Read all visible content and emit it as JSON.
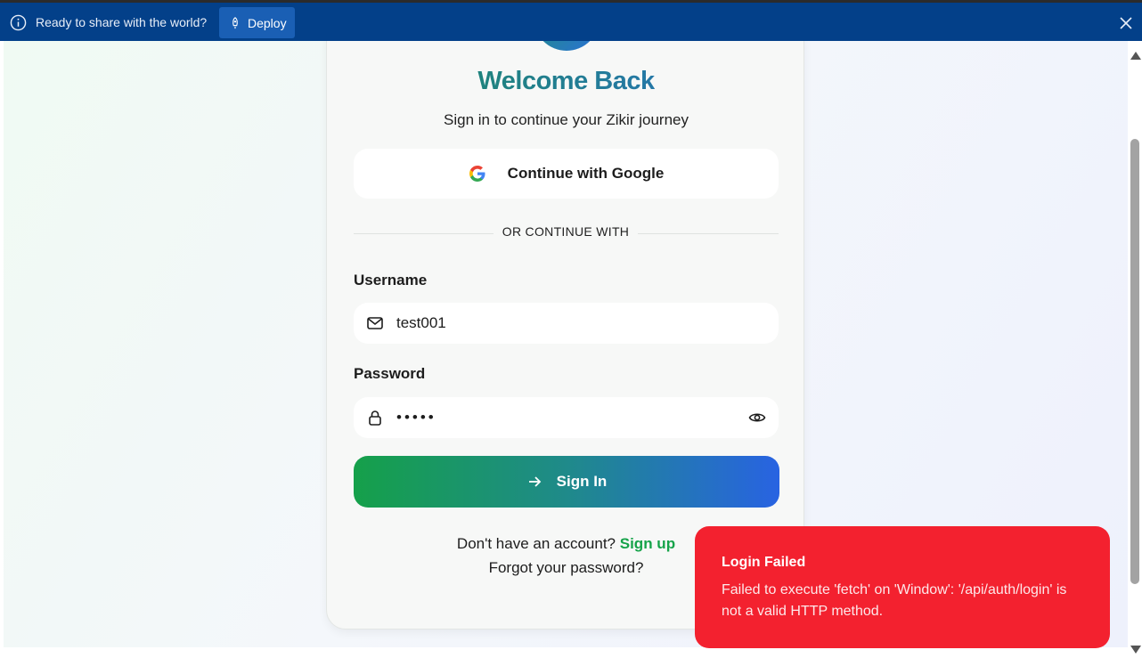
{
  "banner": {
    "message": "Ready to share with the world?",
    "deploy_label": "Deploy"
  },
  "card": {
    "title": "Welcome Back",
    "subtitle": "Sign in to continue your Zikir journey",
    "google_button_label": "Continue with Google",
    "divider_text": "OR CONTINUE WITH",
    "username": {
      "label": "Username",
      "value": "test001"
    },
    "password": {
      "label": "Password",
      "value": "•••••"
    },
    "signin_label": "Sign In",
    "signup_prompt": "Don't have an account?",
    "signup_link": "Sign up",
    "forgot_link": "Forgot your password?"
  },
  "toast": {
    "title": "Login Failed",
    "message": "Failed to execute 'fetch' on 'Window': '/api/auth/login' is not a valid HTTP method."
  },
  "colors": {
    "banner_bg": "#034089",
    "toast_bg": "#f3212f",
    "accent_green": "#16a34a",
    "accent_blue": "#2863e2"
  }
}
